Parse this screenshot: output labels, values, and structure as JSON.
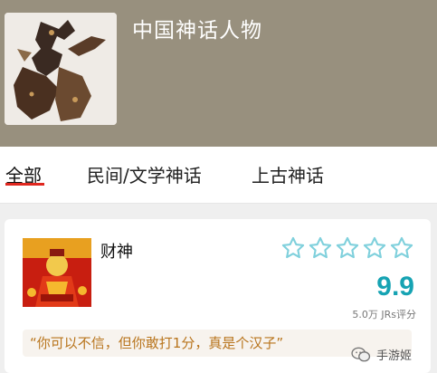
{
  "header": {
    "title": "中国神话人物",
    "cover_icon": "shadow-puppet-cover-image"
  },
  "tabs": [
    {
      "label": "全部",
      "active": true
    },
    {
      "label": "民间/文学神话",
      "active": false
    },
    {
      "label": "上古神话",
      "active": false
    }
  ],
  "item": {
    "name": "财神",
    "thumbnail": "caishen-god-of-wealth-image",
    "stars_total": 5,
    "score": "9.9",
    "rating_count": "5.0万 JRs评分",
    "quote": "“你可以不信，但你敢打1分，真是个汉子”"
  },
  "watermark": {
    "label": "手游姬",
    "icon": "wechat-icon"
  },
  "colors": {
    "header_bg": "#98907e",
    "accent": "#e0271f",
    "score": "#16a3b3",
    "quote_text": "#b8741c"
  }
}
